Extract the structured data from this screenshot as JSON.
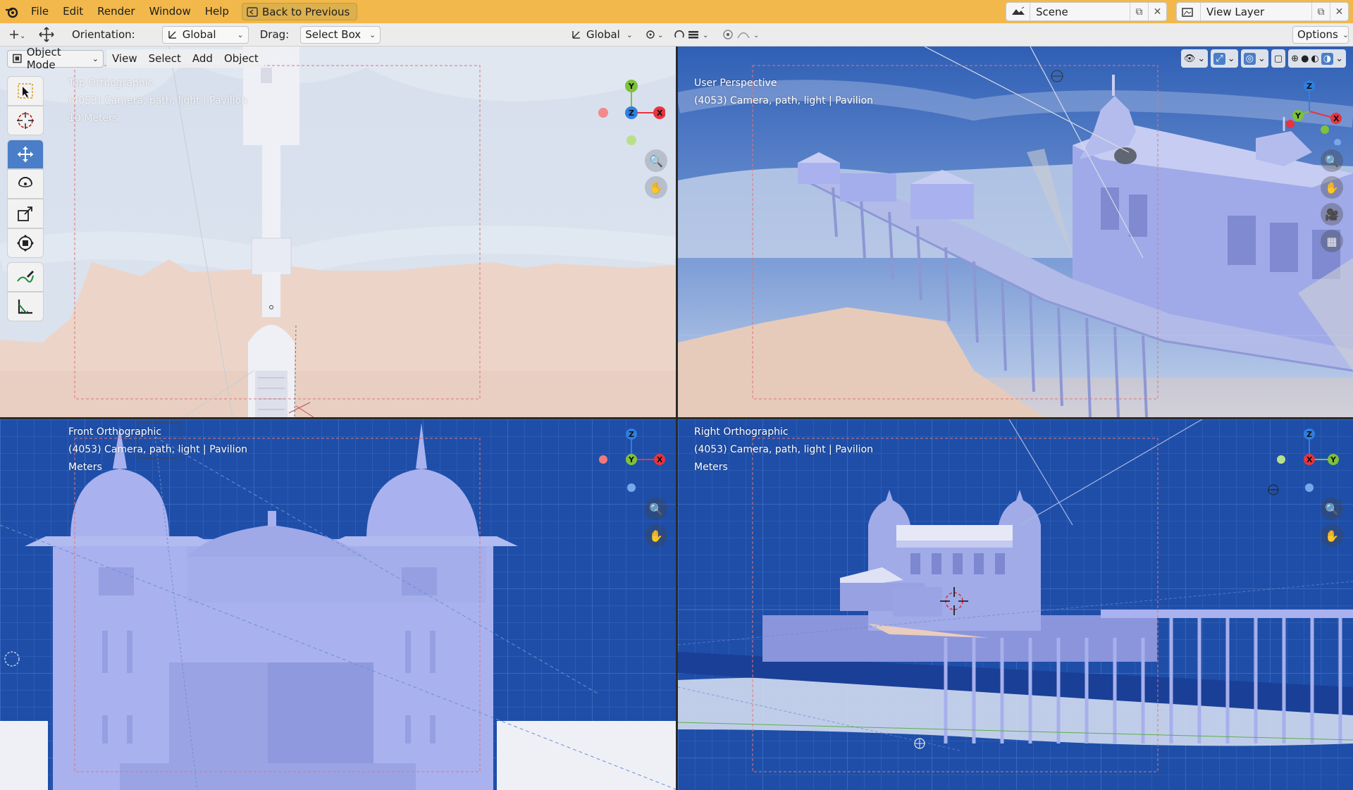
{
  "menu": {
    "items": [
      "File",
      "Edit",
      "Render",
      "Window",
      "Help"
    ],
    "back_button": "Back to Previous"
  },
  "scene_selector": {
    "value": "Scene"
  },
  "view_layer_selector": {
    "value": "View Layer"
  },
  "toolbar": {
    "orientation_label": "Orientation:",
    "orientation_value": "Global",
    "drag_label": "Drag:",
    "drag_value": "Select Box",
    "transform_orientation": "Global",
    "options": "Options"
  },
  "viewport_header": {
    "mode": "Object Mode",
    "menus": [
      "View",
      "Select",
      "Add",
      "Object"
    ]
  },
  "viewports": {
    "top": {
      "title": "Top Orthographic",
      "collection": "(4053) Camera, path, light | Pavilion",
      "scale": "10 Meters"
    },
    "user": {
      "title": "User Perspective",
      "collection": "(4053) Camera, path, light | Pavilion"
    },
    "front": {
      "title": "Front Orthographic",
      "collection": "(4053) Camera, path, light | Pavilion",
      "scale": "Meters"
    },
    "right": {
      "title": "Right Orthographic",
      "collection": "(4053) Camera, path, light | Pavilion",
      "scale": "Meters"
    }
  },
  "gizmo_axes": {
    "x": "X",
    "y": "Y",
    "z": "Z"
  },
  "colors": {
    "header_accent": "#f2b84b",
    "active_tool": "#4a7ec8",
    "axis_x": "#e8343c",
    "axis_y": "#7ec13a",
    "axis_z": "#2f7fe0",
    "grid_bg": "#1e4ea8",
    "model_fill": "#a9b2ee"
  },
  "tools": [
    "select-box-icon",
    "cursor-icon",
    "move-icon",
    "rotate-icon",
    "scale-icon",
    "transform-icon",
    "annotate-icon",
    "measure-icon"
  ]
}
